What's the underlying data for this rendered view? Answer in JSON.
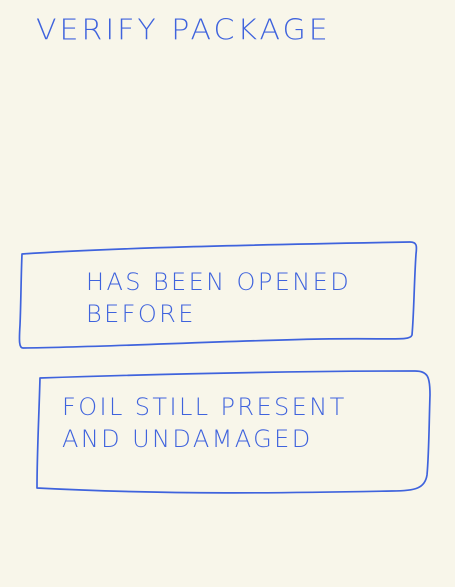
{
  "screen": {
    "title": "VERIFY  PACKAGE"
  },
  "options": [
    {
      "label": "HAS BEEN  OPENED\nBEFORE"
    },
    {
      "label": "FOIL  STILL PRESENT\nAND UNDAMAGED"
    }
  ],
  "colors": {
    "background": "#f8f6ea",
    "ink": "#3f63dd"
  }
}
